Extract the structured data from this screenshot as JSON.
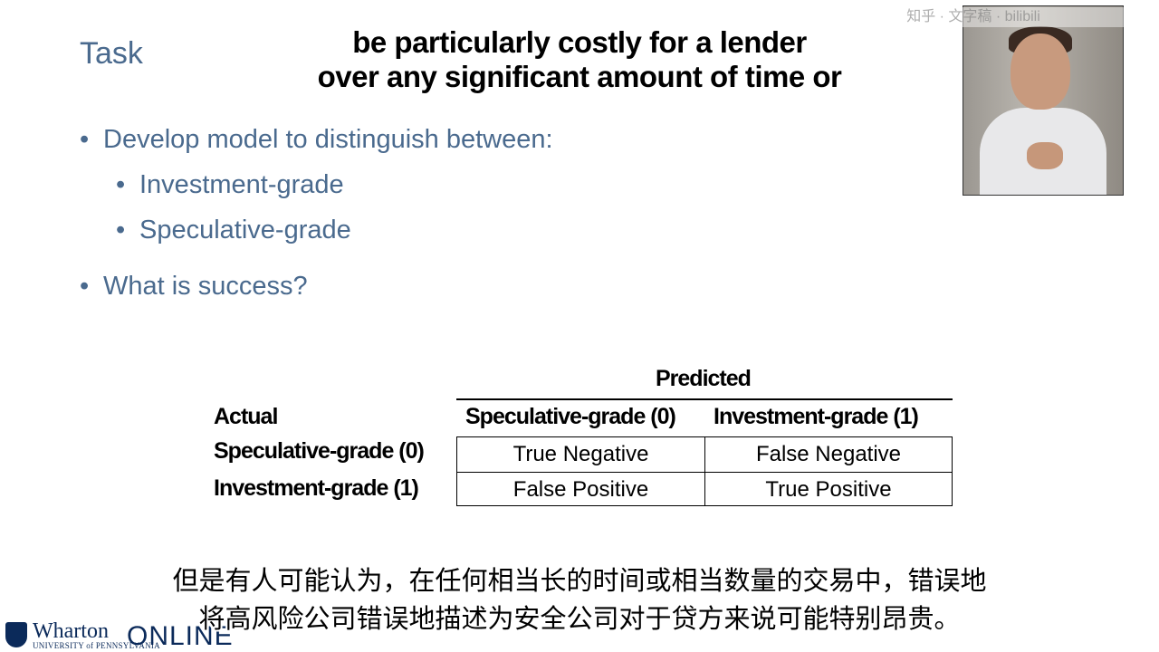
{
  "slide": {
    "title": "Task",
    "bullets": [
      "Develop model to distinguish between:",
      "Investment-grade",
      "Speculative-grade",
      "What is success?"
    ],
    "bullet_glyph": "•"
  },
  "captions": {
    "en_line1": "be particularly costly for a lender",
    "en_line2": "over any significant amount of time or",
    "zh_line1": "但是有人可能认为，在任何相当长的时间或相当数量的交易中，错误地",
    "zh_line2": "将高风险公司错误地描述为安全公司对于贷方来说可能特别昂贵。"
  },
  "matrix": {
    "predicted_label": "Predicted",
    "actual_label": "Actual",
    "columns": [
      "Speculative-grade (0)",
      "Investment-grade (1)"
    ],
    "rows": [
      "Speculative-grade (0)",
      "Investment-grade (1)"
    ],
    "cells": [
      [
        "True Negative",
        "False Negative"
      ],
      [
        "False Positive",
        "True Positive"
      ]
    ]
  },
  "branding": {
    "logo_main": "Wharton",
    "logo_sub": "UNIVERSITY of PENNSYLVANIA",
    "logo_online": "ONLINE",
    "accent": "#4a6a8e",
    "brand_navy": "#0b2a5a"
  },
  "watermark": "知乎 · 文字稿 · bilibili"
}
